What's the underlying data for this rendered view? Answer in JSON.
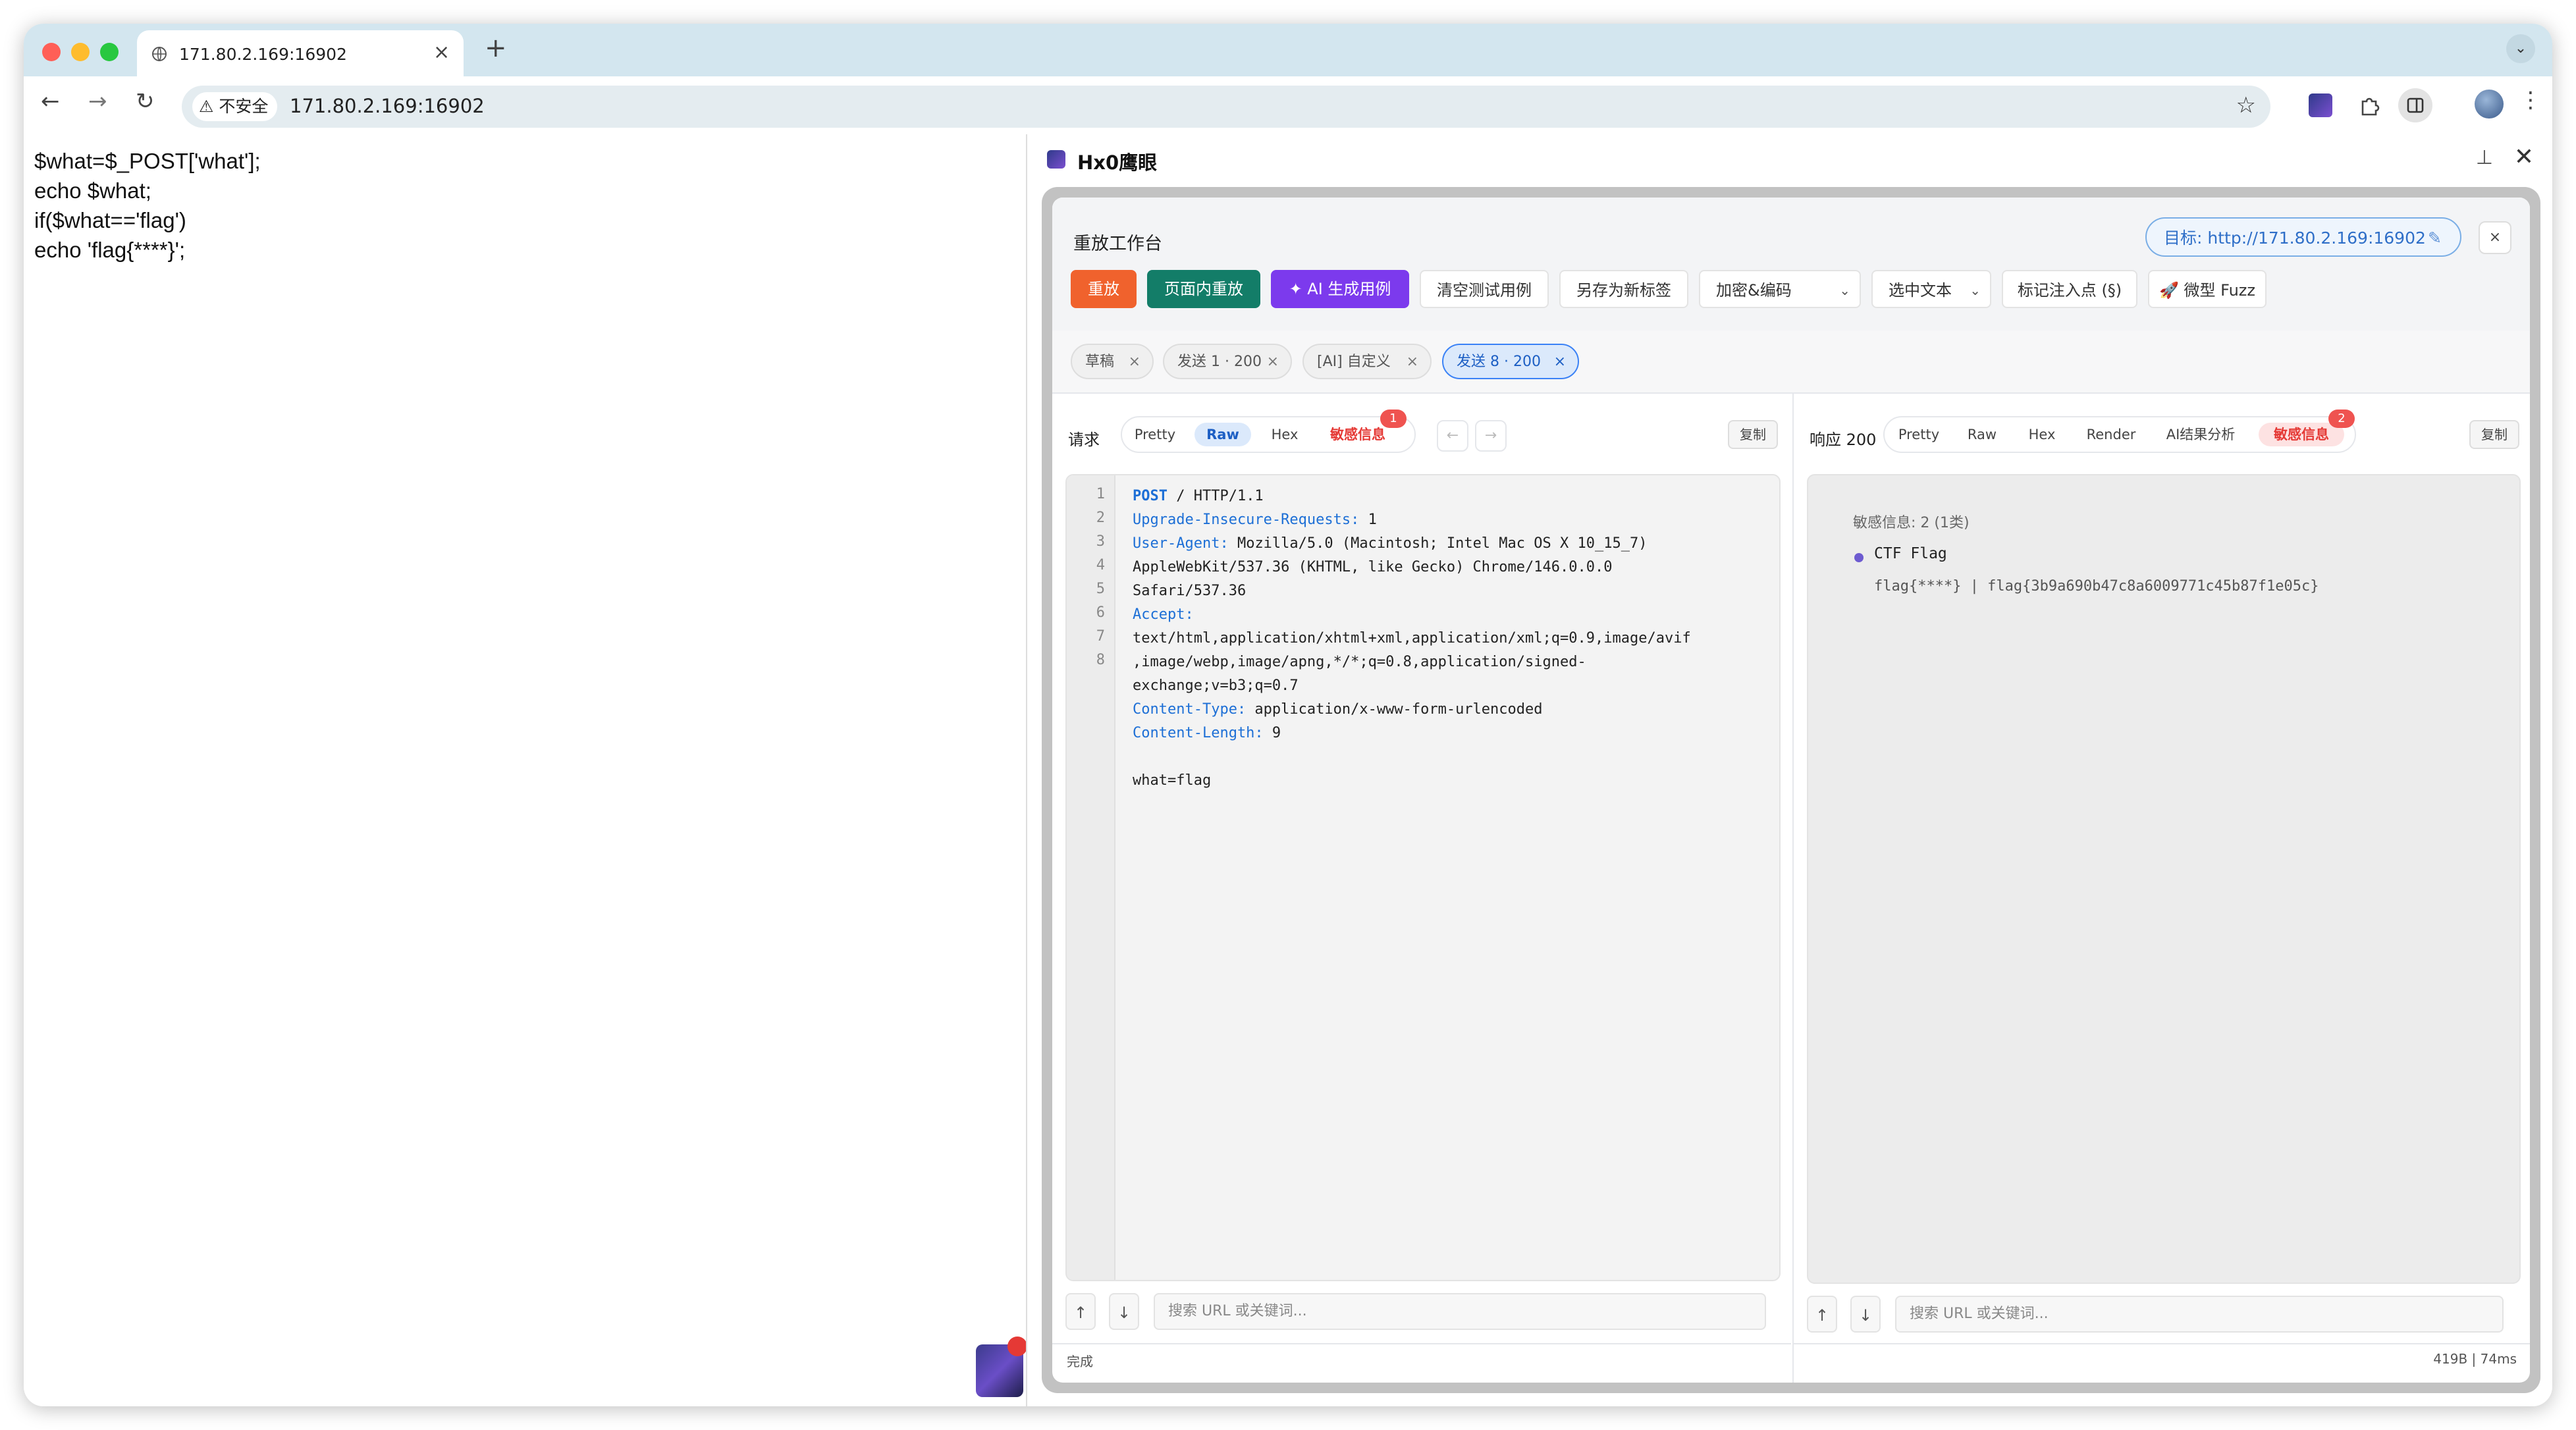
{
  "browser": {
    "tab_title": "171.80.2.169:16902",
    "new_tab": "+",
    "tab_close": "×",
    "security_label": "不安全",
    "url": "171.80.2.169:16902"
  },
  "page": {
    "code_lines": [
      "$what=$_POST['what'];",
      "echo $what;",
      "if($what=='flag')",
      "echo 'flag{****}';"
    ]
  },
  "panel": {
    "name": "Hx0鹰眼",
    "pin_icon": "pin-off-icon",
    "close": "✕",
    "title": "重放工作台",
    "target": "目标: http://171.80.2.169:16902",
    "target_close": "×",
    "buttons": {
      "replay": "重放",
      "inpage_replay": "页面内重放",
      "ai_generate": "✦ AI 生成用例",
      "clear_cases": "清空测试用例",
      "save_new_tab": "另存为新标签",
      "encode": "加密&编码",
      "select_text": "选中文本",
      "mark_injection": "标记注入点 (§)",
      "micro_fuzz": "🚀 微型 Fuzz"
    },
    "tags": [
      {
        "label": "草稿",
        "close": "×"
      },
      {
        "label": "发送 1 · 200",
        "close": "×"
      },
      {
        "label": "[AI] 自定义",
        "close": "×"
      },
      {
        "label": "发送 8 · 200",
        "close": "×"
      }
    ],
    "request": {
      "label": "请求",
      "views": [
        "Pretty",
        "Raw",
        "Hex",
        "敏感信息"
      ],
      "sensitive_badge": "1",
      "prev_arrow": "←",
      "next_arrow": "→",
      "copy": "复制",
      "line_numbers": [
        "1",
        "2",
        "3",
        "4",
        "5",
        "6",
        "7",
        "8"
      ],
      "method": "POST",
      "request_line_rest": " / HTTP/1.1",
      "headers": [
        {
          "key": "Upgrade-Insecure-Requests:",
          "value": " 1"
        },
        {
          "key": "User-Agent:",
          "value": " Mozilla/5.0 (Macintosh; Intel Mac OS X 10_15_7)\nAppleWebKit/537.36 (KHTML, like Gecko) Chrome/146.0.0.0\nSafari/537.36"
        },
        {
          "key": "Accept:",
          "value": "\ntext/html,application/xhtml+xml,application/xml;q=0.9,image/avif\n,image/webp,image/apng,*/*;q=0.8,application/signed-\nexchange;v=b3;q=0.7"
        },
        {
          "key": "Content-Type:",
          "value": " application/x-www-form-urlencoded"
        },
        {
          "key": "Content-Length:",
          "value": " 9"
        }
      ],
      "body": "what=flag",
      "search_placeholder": "搜索 URL 或关键词...",
      "up": "↑",
      "down": "↓",
      "status": "完成"
    },
    "response": {
      "label": "响应 200",
      "views": [
        "Pretty",
        "Raw",
        "Hex",
        "Render",
        "AI结果分析",
        "敏感信息"
      ],
      "sensitive_badge": "2",
      "copy": "复制",
      "sensitive_title": "敏感信息: 2 (1类)",
      "category": "CTF Flag",
      "findings": "flag{****} | flag{3b9a690b47c8a6009771c45b87f1e05c}",
      "search_placeholder": "搜索 URL 或关键词...",
      "up": "↑",
      "down": "↓",
      "stats": "419B | 74ms"
    }
  },
  "colors": {
    "accent_blue": "#1d6fd6",
    "replay_orange": "#f0622d",
    "inpage_teal": "#137d68",
    "ai_purple": "#7c3aed",
    "alert_red": "#e53935"
  }
}
